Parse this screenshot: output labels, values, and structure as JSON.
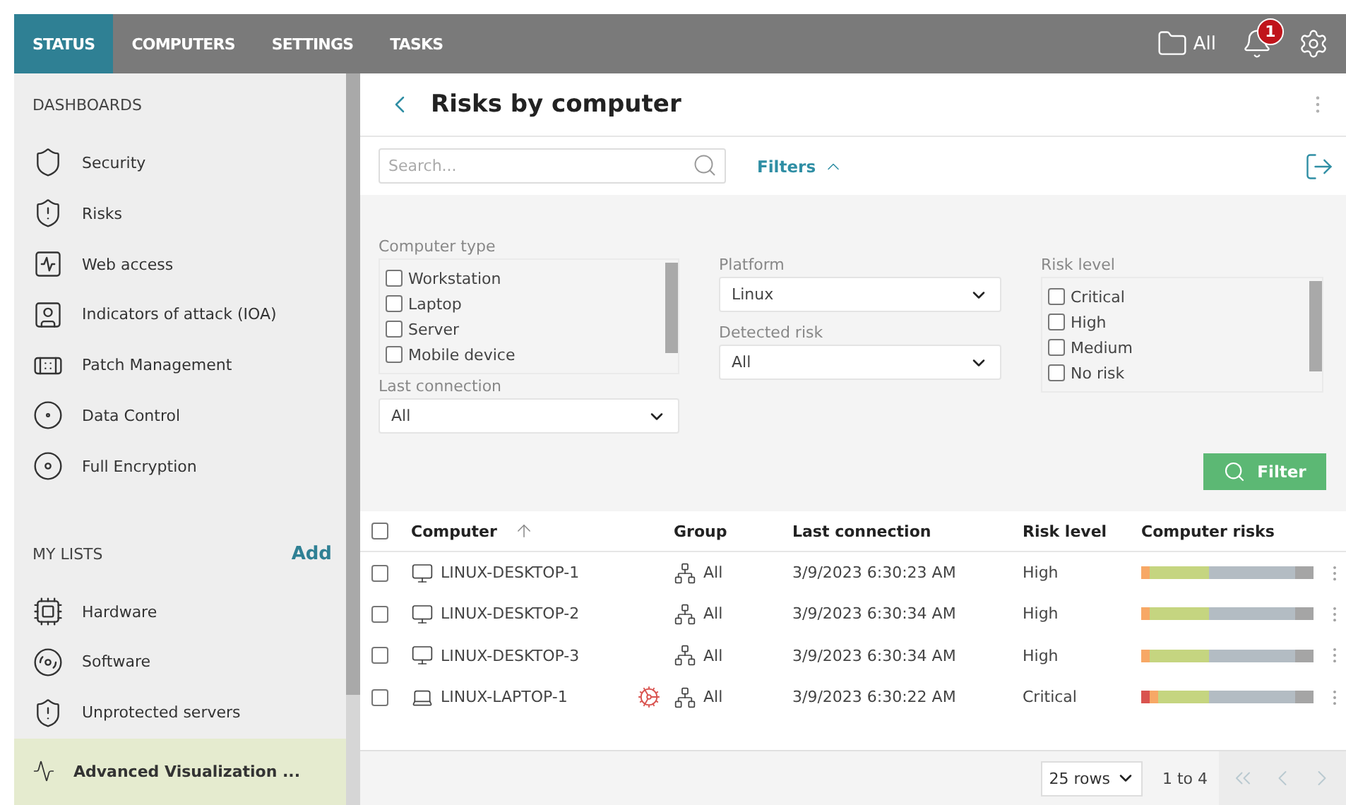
{
  "top_nav": {
    "tabs": [
      {
        "label": "STATUS",
        "selected": true
      },
      {
        "label": "COMPUTERS",
        "selected": false
      },
      {
        "label": "SETTINGS",
        "selected": false
      },
      {
        "label": "TASKS",
        "selected": false
      }
    ],
    "folder_label": "All",
    "notification_count": "1"
  },
  "sidebar": {
    "dashboards_heading": "DASHBOARDS",
    "dashboards": [
      {
        "label": "Security",
        "selected": false
      },
      {
        "label": "Risks",
        "selected": false
      },
      {
        "label": "Web access",
        "selected": false
      },
      {
        "label": "Indicators of attack (IOA)",
        "selected": false
      },
      {
        "label": "Patch Management",
        "selected": false
      },
      {
        "label": "Data Control",
        "selected": false
      },
      {
        "label": "Full Encryption",
        "selected": false
      }
    ],
    "lists_heading": "MY LISTS",
    "add_label": "Add",
    "lists": [
      {
        "label": "Hardware",
        "selected": false
      },
      {
        "label": "Software",
        "selected": false
      },
      {
        "label": "Unprotected servers",
        "selected": false
      },
      {
        "label": "Advanced Visualization ...",
        "selected": true
      }
    ]
  },
  "page": {
    "title": "Risks by computer",
    "search": {
      "placeholder": "Search..."
    },
    "filters_label": "Filters",
    "filters": {
      "computer_type": {
        "label": "Computer type",
        "options": [
          {
            "label": "Workstation",
            "checked": false
          },
          {
            "label": "Laptop",
            "checked": false
          },
          {
            "label": "Server",
            "checked": false
          },
          {
            "label": "Mobile device",
            "checked": false
          }
        ]
      },
      "last_connection": {
        "label": "Last connection",
        "value": "All"
      },
      "platform": {
        "label": "Platform",
        "value": "Linux"
      },
      "detected_risk": {
        "label": "Detected risk",
        "value": "All"
      },
      "risk_level": {
        "label": "Risk level",
        "options": [
          {
            "label": "Critical",
            "checked": false
          },
          {
            "label": "High",
            "checked": false
          },
          {
            "label": "Medium",
            "checked": false
          },
          {
            "label": "No risk",
            "checked": false
          }
        ]
      },
      "filter_button": "Filter"
    }
  },
  "table": {
    "all_checked": false,
    "columns": [
      "Computer",
      "Group",
      "Last connection",
      "Risk level",
      "Computer risks"
    ],
    "rows": [
      {
        "checked": false,
        "kind": "desktop",
        "computer": "LINUX-DESKTOP-1",
        "alert": false,
        "group": "All",
        "last_connection": "3/9/2023 6:30:23 AM",
        "risk_level": "High",
        "risks": [
          {
            "color": "#f7a866"
          },
          {
            "color": "#c5d580"
          },
          {
            "color": "#b3bcc3"
          },
          {
            "color": "#a5a5a5"
          }
        ]
      },
      {
        "checked": false,
        "kind": "desktop",
        "computer": "LINUX-DESKTOP-2",
        "alert": false,
        "group": "All",
        "last_connection": "3/9/2023 6:30:34 AM",
        "risk_level": "High",
        "risks": [
          {
            "color": "#f7a866"
          },
          {
            "color": "#c5d580"
          },
          {
            "color": "#b3bcc3"
          },
          {
            "color": "#a5a5a5"
          }
        ]
      },
      {
        "checked": false,
        "kind": "desktop",
        "computer": "LINUX-DESKTOP-3",
        "alert": false,
        "group": "All",
        "last_connection": "3/9/2023 6:30:34 AM",
        "risk_level": "High",
        "risks": [
          {
            "color": "#f7a866"
          },
          {
            "color": "#c5d580"
          },
          {
            "color": "#b3bcc3"
          },
          {
            "color": "#a5a5a5"
          }
        ]
      },
      {
        "checked": false,
        "kind": "laptop",
        "computer": "LINUX-LAPTOP-1",
        "alert": true,
        "group": "All",
        "last_connection": "3/9/2023 6:30:22 AM",
        "risk_level": "Critical",
        "risks": [
          {
            "color": "#d9534f"
          },
          {
            "color": "#f7a866"
          },
          {
            "color": "#c5d580"
          },
          {
            "color": "#b3bcc3"
          },
          {
            "color": "#a5a5a5"
          }
        ]
      }
    ]
  },
  "footer": {
    "rows_per_page": "25 rows",
    "range": "1 to 4"
  }
}
